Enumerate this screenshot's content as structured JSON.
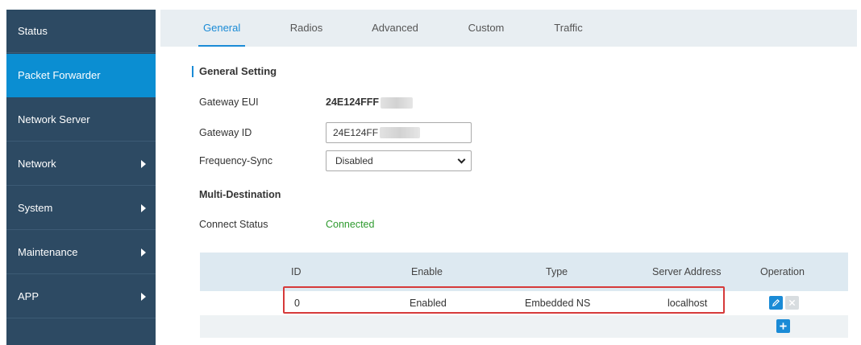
{
  "sidebar": {
    "items": [
      {
        "label": "Status"
      },
      {
        "label": "Packet Forwarder"
      },
      {
        "label": "Network Server"
      },
      {
        "label": "Network"
      },
      {
        "label": "System"
      },
      {
        "label": "Maintenance"
      },
      {
        "label": "APP"
      }
    ]
  },
  "tabs": [
    {
      "label": "General"
    },
    {
      "label": "Radios"
    },
    {
      "label": "Advanced"
    },
    {
      "label": "Custom"
    },
    {
      "label": "Traffic"
    }
  ],
  "general_setting": {
    "title": "General Setting",
    "gateway_eui_label": "Gateway EUI",
    "gateway_eui_value": "24E124FFF",
    "gateway_id_label": "Gateway ID",
    "gateway_id_value": "24E124FF",
    "frequency_sync_label": "Frequency-Sync",
    "frequency_sync_value": "Disabled",
    "multi_destination_label": "Multi-Destination",
    "connect_status_label": "Connect Status",
    "connect_status_value": "Connected"
  },
  "table": {
    "headers": {
      "id": "ID",
      "enable": "Enable",
      "type": "Type",
      "server_address": "Server Address",
      "operation": "Operation"
    },
    "rows": [
      {
        "id": "0",
        "enable": "Enabled",
        "type": "Embedded NS",
        "server_address": "localhost"
      }
    ]
  },
  "icons": {
    "edit": "pencil-icon",
    "delete": "close-icon",
    "add": "plus-icon",
    "expand": "chevron-right-icon"
  },
  "colors": {
    "sidebar_bg": "#2d4a63",
    "sidebar_active": "#0b8ed2",
    "accent": "#1a8bd6",
    "status_ok": "#2e9a2e",
    "highlight": "#d63a3a"
  }
}
